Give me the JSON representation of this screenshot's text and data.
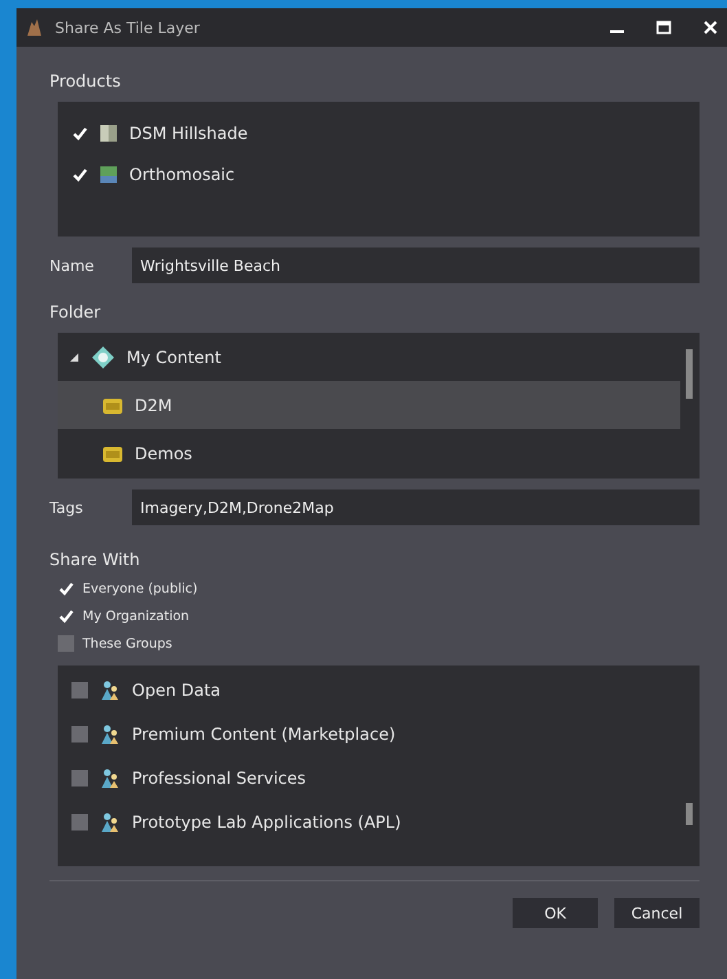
{
  "window": {
    "title": "Share As Tile Layer"
  },
  "products": {
    "label": "Products",
    "items": [
      {
        "name": "DSM Hillshade",
        "checked": true,
        "kind": "hillshade"
      },
      {
        "name": "Orthomosaic",
        "checked": true,
        "kind": "ortho"
      }
    ]
  },
  "name_field": {
    "label": "Name",
    "value": "Wrightsville Beach"
  },
  "folder": {
    "label": "Folder",
    "tree": [
      {
        "name": "My Content",
        "expanded": true,
        "selected": false,
        "children": [
          {
            "name": "D2M",
            "selected": true
          },
          {
            "name": "Demos",
            "selected": false
          }
        ]
      }
    ]
  },
  "tags_field": {
    "label": "Tags",
    "value": "Imagery,D2M,Drone2Map"
  },
  "share_with": {
    "label": "Share With",
    "options": [
      {
        "label": "Everyone (public)",
        "checked": true
      },
      {
        "label": "My Organization",
        "checked": true
      },
      {
        "label": "These Groups",
        "checked": false
      }
    ]
  },
  "groups": [
    {
      "name": "Open Data",
      "checked": false
    },
    {
      "name": "Premium Content (Marketplace)",
      "checked": false
    },
    {
      "name": "Professional Services",
      "checked": false
    },
    {
      "name": "Prototype Lab Applications (APL)",
      "checked": false
    }
  ],
  "buttons": [
    "OK",
    "Cancel"
  ]
}
